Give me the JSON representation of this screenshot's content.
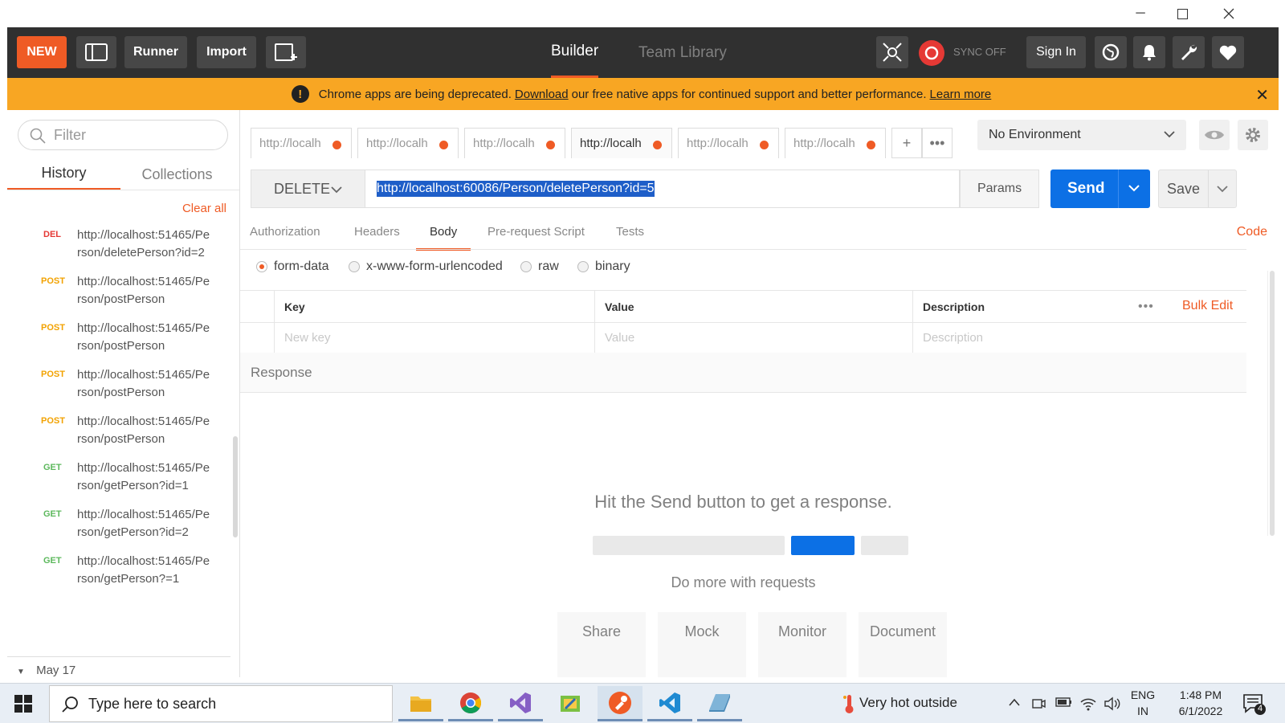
{
  "header": {
    "new_label": "NEW",
    "runner_label": "Runner",
    "import_label": "Import",
    "tabs": [
      {
        "label": "Builder"
      },
      {
        "label": "Team Library"
      }
    ],
    "sync_label": "SYNC OFF",
    "signin_label": "Sign In"
  },
  "banner": {
    "text_before": "Chrome apps are being deprecated.",
    "download_link": "Download",
    "text_after": "our free native apps for continued support and better performance.",
    "learn_more": "Learn more"
  },
  "sidebar": {
    "filter_placeholder": "Filter",
    "tabs": [
      {
        "label": "History"
      },
      {
        "label": "Collections"
      }
    ],
    "clear_all": "Clear all",
    "history": [
      {
        "method": "DEL",
        "url": "http://localhost:51465/Person/deletePerson?id=2"
      },
      {
        "method": "POST",
        "url": "http://localhost:51465/Person/postPerson"
      },
      {
        "method": "POST",
        "url": "http://localhost:51465/Person/postPerson"
      },
      {
        "method": "POST",
        "url": "http://localhost:51465/Person/postPerson"
      },
      {
        "method": "POST",
        "url": "http://localhost:51465/Person/postPerson"
      },
      {
        "method": "GET",
        "url": "http://localhost:51465/Person/getPerson?id=1"
      },
      {
        "method": "GET",
        "url": "http://localhost:51465/Person/getPerson?id=2"
      },
      {
        "method": "GET",
        "url": "http://localhost:51465/Person/getPerson?=1"
      }
    ],
    "day_label": "May 17"
  },
  "request_tabs": [
    {
      "label": "http://localh"
    },
    {
      "label": "http://localh"
    },
    {
      "label": "http://localh"
    },
    {
      "label": "http://localh"
    },
    {
      "label": "http://localh"
    },
    {
      "label": "http://localh"
    }
  ],
  "environment": {
    "selected": "No Environment"
  },
  "request": {
    "method": "DELETE",
    "url": "http://localhost:60086/Person/deletePerson?id=5",
    "params_label": "Params",
    "send_label": "Send",
    "save_label": "Save"
  },
  "sub_tabs": [
    {
      "label": "Authorization"
    },
    {
      "label": "Headers"
    },
    {
      "label": "Body"
    },
    {
      "label": "Pre-request Script"
    },
    {
      "label": "Tests"
    }
  ],
  "code_label": "Code",
  "body_modes": [
    {
      "label": "form-data",
      "selected": true
    },
    {
      "label": "x-www-form-urlencoded",
      "selected": false
    },
    {
      "label": "raw",
      "selected": false
    },
    {
      "label": "binary",
      "selected": false
    }
  ],
  "kv_table": {
    "headers": {
      "key": "Key",
      "value": "Value",
      "description": "Description"
    },
    "bulk_edit": "Bulk Edit",
    "placeholders": {
      "key": "New key",
      "value": "Value",
      "description": "Description"
    }
  },
  "response": {
    "title": "Response",
    "empty_message": "Hit the Send button to get a response.",
    "more_text": "Do more with requests",
    "tiles": [
      {
        "label": "Share"
      },
      {
        "label": "Mock"
      },
      {
        "label": "Monitor"
      },
      {
        "label": "Document"
      }
    ]
  },
  "taskbar": {
    "search_placeholder": "Type here to search",
    "weather": "Very hot outside",
    "lang": "ENG",
    "region": "IN",
    "time": "1:48 PM",
    "date": "6/1/2022",
    "notifications": "4"
  },
  "colors": {
    "accent": "#ef5b25",
    "send_blue": "#0c70e5",
    "banner": "#f8a623",
    "header": "#303030"
  }
}
